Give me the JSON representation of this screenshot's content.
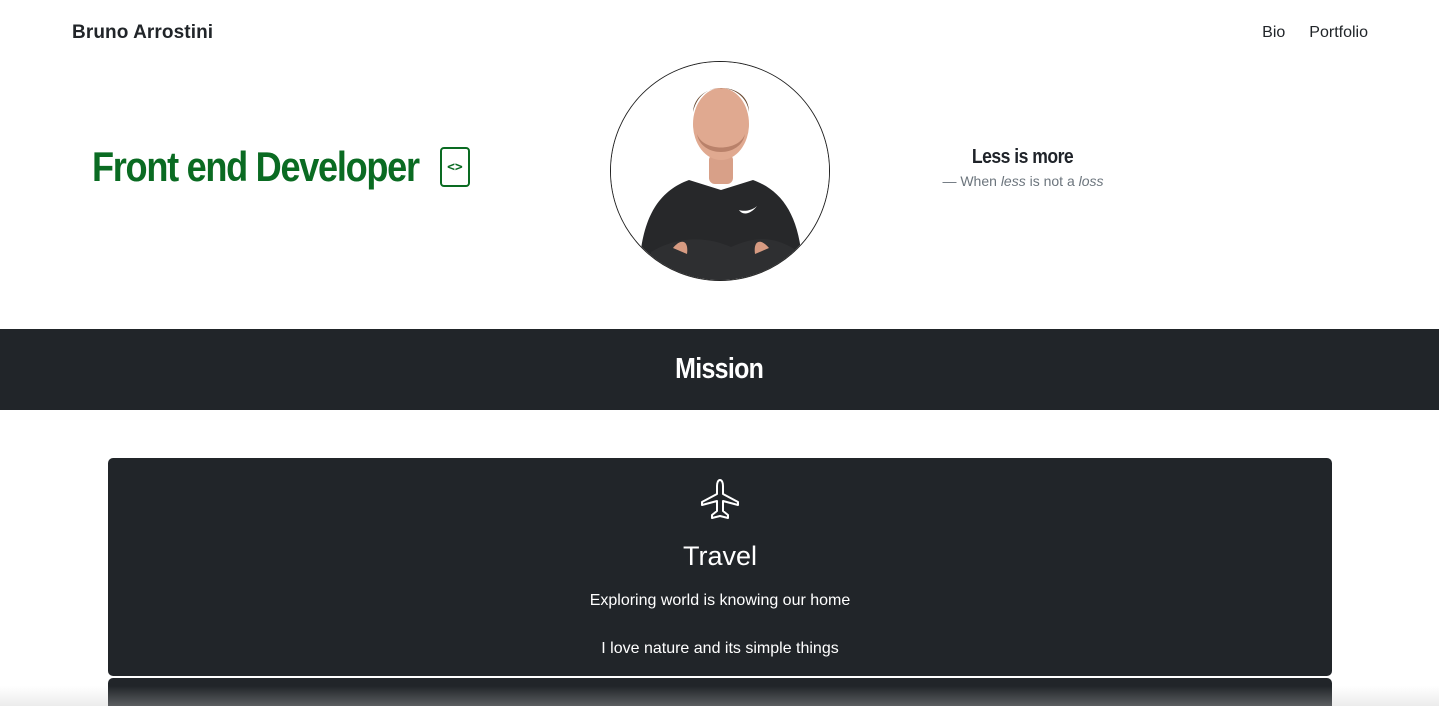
{
  "navbar": {
    "brand": "Bruno Arrostini",
    "links": [
      "Bio",
      "Portfolio"
    ]
  },
  "hero": {
    "title": "Front end Developer",
    "badge_icon": "code-icon",
    "badge_symbol": "<>",
    "avatar_icon": "profile-photo"
  },
  "quote": {
    "title": "Less is more",
    "dash": "—",
    "caption_parts": [
      "When",
      "less",
      "is not a",
      "loss"
    ]
  },
  "mission": {
    "title": "Mission"
  },
  "cards": [
    {
      "icon": "airplane-icon",
      "title": "Travel",
      "lines": [
        "Exploring world is knowing our home",
        "I love nature and its simple things"
      ]
    }
  ],
  "colors": {
    "accent_green": "#0a6b22",
    "dark": "#212529",
    "muted": "#6c757d",
    "white": "#ffffff"
  }
}
